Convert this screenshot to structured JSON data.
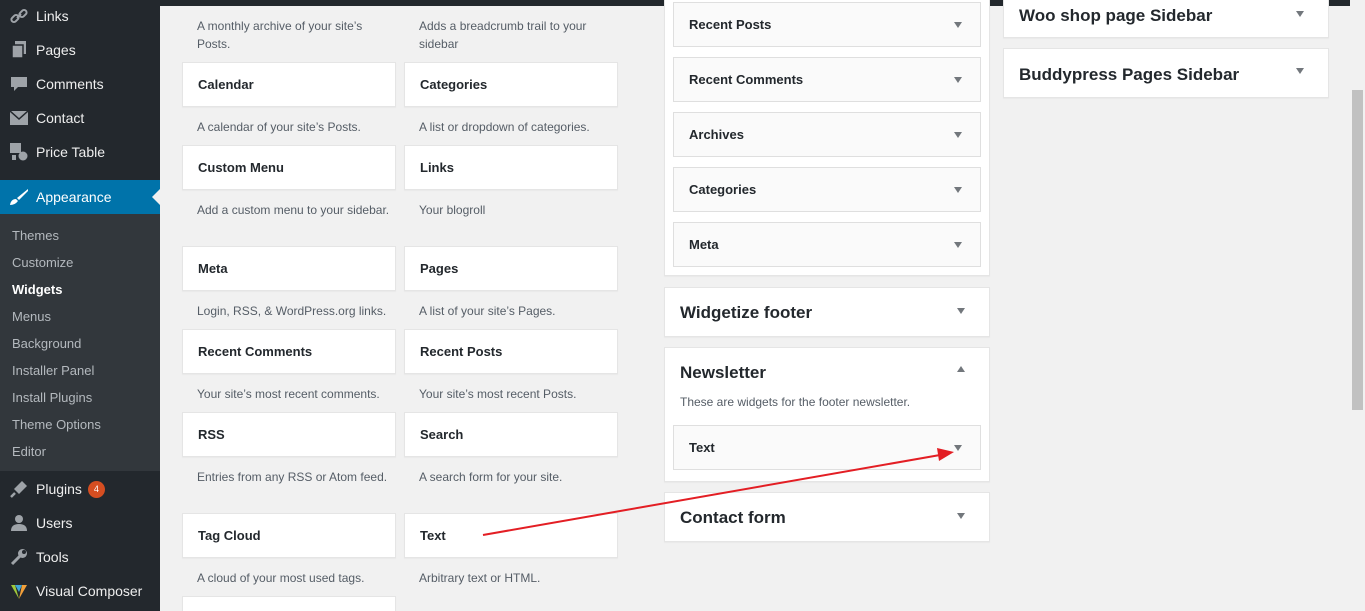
{
  "colors": {
    "sidebar_bg": "#23282d",
    "submenu_bg": "#32373c",
    "accent": "#0073aa",
    "badge": "#d54e21",
    "annotation_arrow": "#e31e24"
  },
  "menu": {
    "items": [
      {
        "label": "Links",
        "icon": "links-icon"
      },
      {
        "label": "Pages",
        "icon": "pages-icon"
      },
      {
        "label": "Comments",
        "icon": "comments-icon"
      },
      {
        "label": "Contact",
        "icon": "mail-icon"
      },
      {
        "label": "Price Table",
        "icon": "price-table-icon"
      },
      {
        "label": "Appearance",
        "icon": "appearance-brush-icon"
      },
      {
        "label": "Plugins",
        "icon": "plugins-icon",
        "badge": "4"
      },
      {
        "label": "Users",
        "icon": "users-icon"
      },
      {
        "label": "Tools",
        "icon": "tools-icon"
      },
      {
        "label": "Visual Composer",
        "icon": "visual-composer-icon"
      }
    ],
    "submenu": [
      "Themes",
      "Customize",
      "Widgets",
      "Menus",
      "Background",
      "Installer Panel",
      "Install Plugins",
      "Theme Options",
      "Editor"
    ]
  },
  "available_widgets": {
    "top_descriptions": [
      "A monthly archive of your site’s Posts.",
      "Adds a breadcrumb trail to your sidebar"
    ],
    "widgets": [
      {
        "name": "Calendar",
        "desc": "A calendar of your site’s Posts."
      },
      {
        "name": "Categories",
        "desc": "A list or dropdown of categories."
      },
      {
        "name": "Custom Menu",
        "desc": "Add a custom menu to your sidebar."
      },
      {
        "name": "Links",
        "desc": "Your blogroll"
      },
      {
        "name": "Meta",
        "desc": "Login, RSS, & WordPress.org links."
      },
      {
        "name": "Pages",
        "desc": "A list of your site’s Pages."
      },
      {
        "name": "Recent Comments",
        "desc": "Your site’s most recent comments."
      },
      {
        "name": "Recent Posts",
        "desc": "Your site’s most recent Posts."
      },
      {
        "name": "RSS",
        "desc": "Entries from any RSS or Atom feed."
      },
      {
        "name": "Search",
        "desc": "A search form for your site."
      },
      {
        "name": "Tag Cloud",
        "desc": "A cloud of your most used tags."
      },
      {
        "name": "Text",
        "desc": "Arbitrary text or HTML."
      }
    ]
  },
  "sidebar_widgets": [
    "Recent Posts",
    "Recent Comments",
    "Archives",
    "Categories",
    "Meta"
  ],
  "areas": {
    "widgetize_footer": "Widgetize footer",
    "newsletter": {
      "title": "Newsletter",
      "desc": "These are widgets for the footer newsletter.",
      "widgets": [
        "Text"
      ]
    },
    "contact_form": "Contact form",
    "woo_shop": "Woo shop page Sidebar",
    "buddypress": "Buddypress Pages Sidebar"
  }
}
